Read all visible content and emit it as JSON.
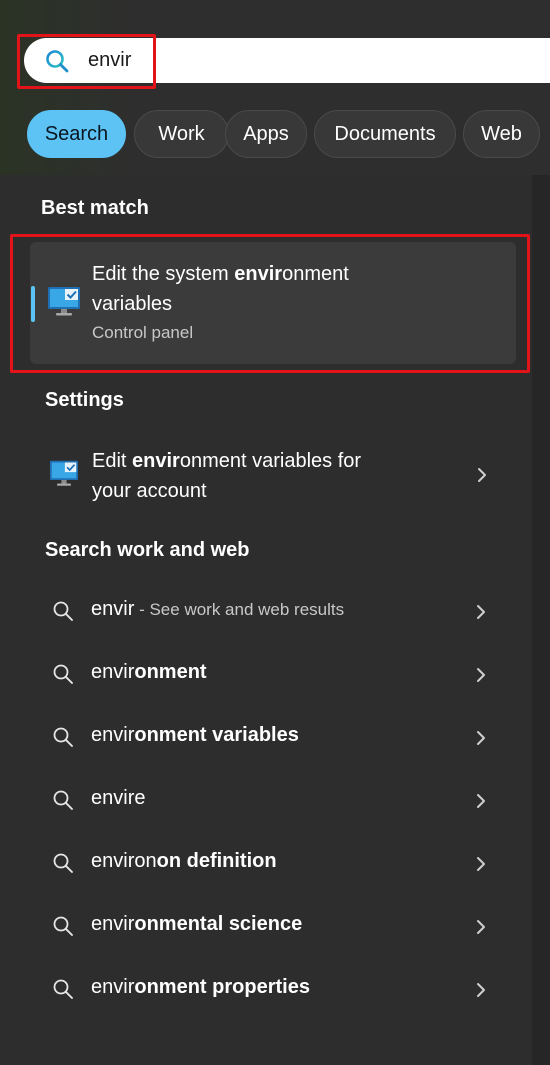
{
  "search": {
    "query": "envir"
  },
  "filters": [
    {
      "label": "Search",
      "active": true
    },
    {
      "label": "Work",
      "active": false
    },
    {
      "label": "Apps",
      "active": false
    },
    {
      "label": "Documents",
      "active": false
    },
    {
      "label": "Web",
      "active": false
    }
  ],
  "best_match": {
    "section_title": "Best match",
    "title_pre": "Edit the system ",
    "title_bold": "envir",
    "title_post": "onment",
    "title_line2": "variables",
    "subtitle": "Control panel",
    "icon": "monitor-settings-icon"
  },
  "settings": {
    "section_title": "Settings",
    "item_pre": "Edit ",
    "item_bold": "envir",
    "item_post": "onment variables for",
    "item_line2": "your account",
    "icon": "monitor-settings-icon"
  },
  "web": {
    "section_title": "Search work and web",
    "results": [
      {
        "normal": "envir",
        "bold": "",
        "muted": " - See work and web results"
      },
      {
        "normal": "envir",
        "bold": "onment",
        "muted": ""
      },
      {
        "normal": "envir",
        "bold": "onment variables",
        "muted": ""
      },
      {
        "normal": "envire",
        "bold": "",
        "muted": ""
      },
      {
        "normal": "environ",
        "bold": "on definition",
        "muted": ""
      },
      {
        "normal": "envir",
        "bold": "onmental science",
        "muted": ""
      },
      {
        "normal": "envir",
        "bold": "onment properties",
        "muted": ""
      }
    ]
  },
  "colors": {
    "accent": "#5cc3f4",
    "highlight": "#e2141a",
    "panel": "#2d2d2d"
  }
}
